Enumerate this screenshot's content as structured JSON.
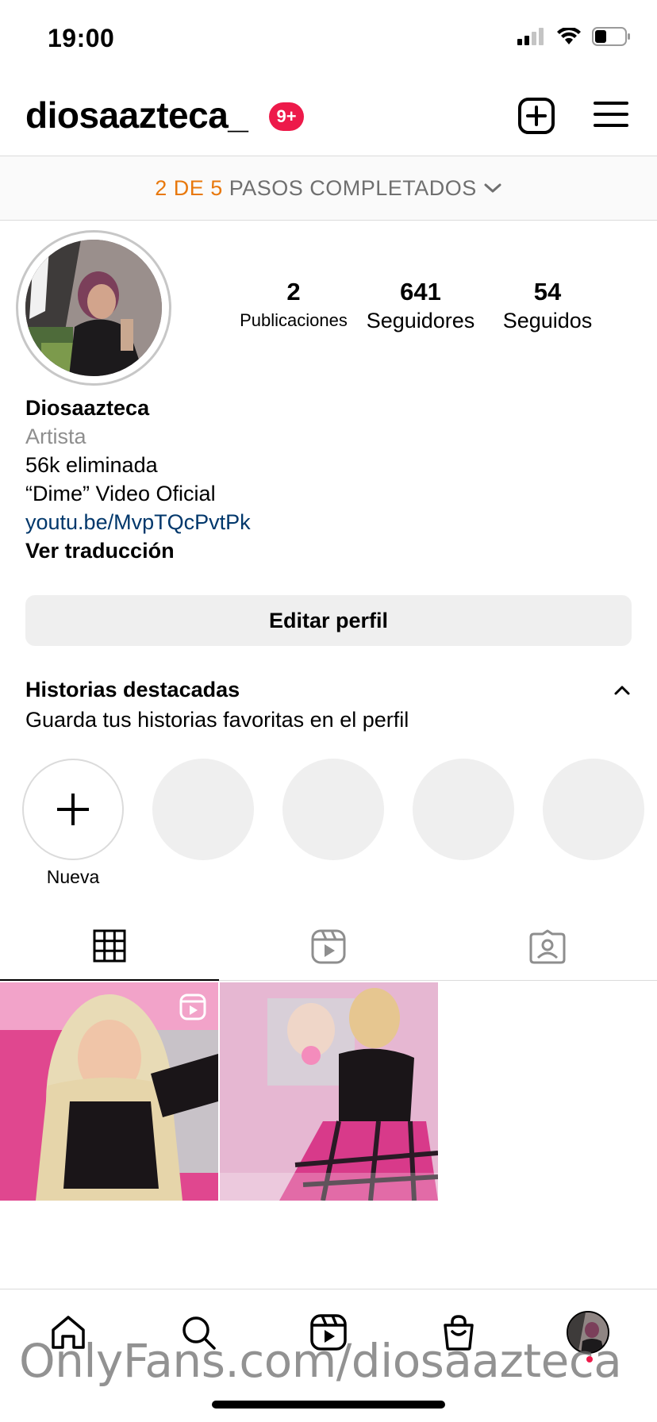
{
  "status_bar": {
    "time": "19:00"
  },
  "header": {
    "username": "diosaazteca_",
    "notification_badge": "9+"
  },
  "setup": {
    "steps_count": "2 DE 5",
    "steps_text": "PASOS COMPLETADOS"
  },
  "stats": [
    {
      "value": "2",
      "label": "Publicaciones"
    },
    {
      "value": "641",
      "label": "Seguidores"
    },
    {
      "value": "54",
      "label": "Seguidos"
    }
  ],
  "bio": {
    "name": "Diosaazteca",
    "category": "Artista",
    "line1": "56k eliminada",
    "line2": "“Dime” Video Oficial",
    "link": "youtu.be/MvpTQcPvtPk",
    "translate": "Ver traducción"
  },
  "edit_profile_label": "Editar perfil",
  "highlights": {
    "title": "Historias destacadas",
    "subtitle": "Guarda tus historias favoritas en el perfil",
    "new_label": "Nueva"
  },
  "watermark": "OnlyFans.com/diosaazteca",
  "colors": {
    "accent_orange": "#e8780c",
    "badge_red": "#ed1a4a",
    "link_blue": "#00376b",
    "divider": "#dbdbdb"
  },
  "icons": {
    "status": [
      "signal-icon",
      "wifi-icon",
      "battery-icon"
    ],
    "header": [
      "add-post-icon",
      "menu-icon"
    ],
    "tabs": [
      "grid-icon",
      "reels-icon",
      "tagged-icon"
    ],
    "nav": [
      "home-icon",
      "search-icon",
      "reels-icon",
      "shop-icon",
      "profile-avatar"
    ]
  }
}
